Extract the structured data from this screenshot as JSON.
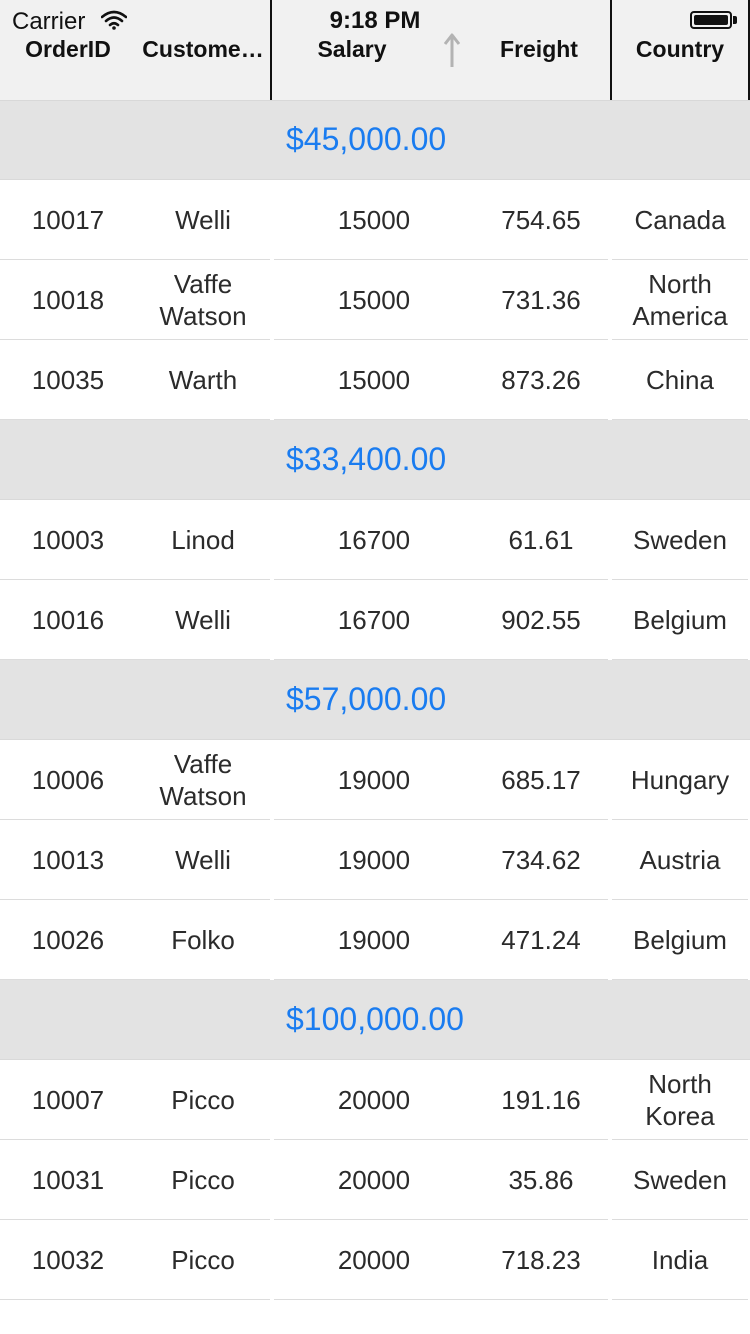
{
  "status_bar": {
    "carrier": "Carrier",
    "time": "9:18 PM"
  },
  "columns": {
    "order_id": "OrderID",
    "customer": "Custome…",
    "salary": "Salary",
    "freight": "Freight",
    "country": "Country"
  },
  "sort": {
    "column": "Salary",
    "direction": "ascending"
  },
  "groups": [
    {
      "caption": "$45,000.00",
      "rows": [
        {
          "order_id": "10017",
          "customer": "Welli",
          "salary": "15000",
          "freight": "754.65",
          "country": "Canada"
        },
        {
          "order_id": "10018",
          "customer": "Vaffe Watson",
          "salary": "15000",
          "freight": "731.36",
          "country": "North America"
        },
        {
          "order_id": "10035",
          "customer": "Warth",
          "salary": "15000",
          "freight": "873.26",
          "country": "China"
        }
      ]
    },
    {
      "caption": "$33,400.00",
      "rows": [
        {
          "order_id": "10003",
          "customer": "Linod",
          "salary": "16700",
          "freight": "61.61",
          "country": "Sweden"
        },
        {
          "order_id": "10016",
          "customer": "Welli",
          "salary": "16700",
          "freight": "902.55",
          "country": "Belgium"
        }
      ]
    },
    {
      "caption": "$57,000.00",
      "rows": [
        {
          "order_id": "10006",
          "customer": "Vaffe Watson",
          "salary": "19000",
          "freight": "685.17",
          "country": "Hungary"
        },
        {
          "order_id": "10013",
          "customer": "Welli",
          "salary": "19000",
          "freight": "734.62",
          "country": "Austria"
        },
        {
          "order_id": "10026",
          "customer": "Folko",
          "salary": "19000",
          "freight": "471.24",
          "country": "Belgium"
        }
      ]
    },
    {
      "caption": "$100,000.00",
      "rows": [
        {
          "order_id": "10007",
          "customer": "Picco",
          "salary": "20000",
          "freight": "191.16",
          "country": "North Korea"
        },
        {
          "order_id": "10031",
          "customer": "Picco",
          "salary": "20000",
          "freight": "35.86",
          "country": "Sweden"
        },
        {
          "order_id": "10032",
          "customer": "Picco",
          "salary": "20000",
          "freight": "718.23",
          "country": "India"
        }
      ]
    }
  ],
  "colors": {
    "group_caption": "#1a7cf0",
    "group_background": "#e3e3e3",
    "header_background": "#f1f1f1"
  }
}
